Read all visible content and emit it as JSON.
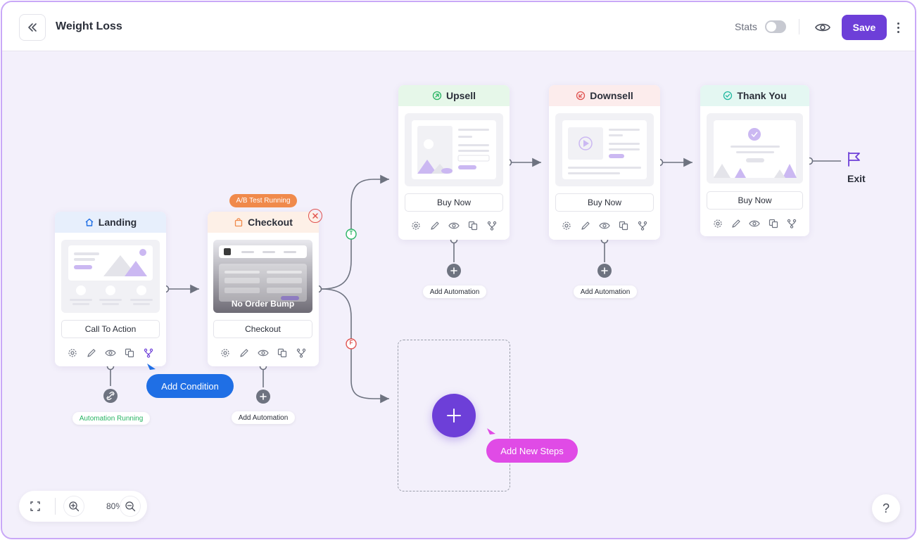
{
  "header": {
    "title": "Weight Loss",
    "stats_label": "Stats",
    "save_label": "Save"
  },
  "steps": {
    "landing": {
      "title": "Landing",
      "button": "Call To Action",
      "status": "Automation Running"
    },
    "checkout": {
      "title": "Checkout",
      "button": "Checkout",
      "badge": "A/B Test Running",
      "overlay": "No Order Bump",
      "automation": "Add Automation"
    },
    "upsell": {
      "title": "Upsell",
      "button": "Buy Now",
      "automation": "Add Automation"
    },
    "downsell": {
      "title": "Downsell",
      "button": "Buy Now",
      "automation": "Add Automation"
    },
    "thankyou": {
      "title": "Thank You",
      "button": "Buy Now"
    }
  },
  "branches": {
    "true_label": "T",
    "false_label": "F"
  },
  "actions": {
    "add_condition": "Add Condition",
    "add_new_steps": "Add New Steps",
    "exit": "Exit"
  },
  "zoom": {
    "level": "80%"
  },
  "help": {
    "label": "?"
  },
  "colors": {
    "accent": "#6d3fd8",
    "condition": "#1f6fe5",
    "steps": "#e04be6",
    "landing_head": "#e7effc",
    "checkout_head": "#fdf0e7",
    "upsell_head": "#e6f7e9",
    "downsell_head": "#fcecec",
    "thankyou_head": "#e4f7f2"
  }
}
